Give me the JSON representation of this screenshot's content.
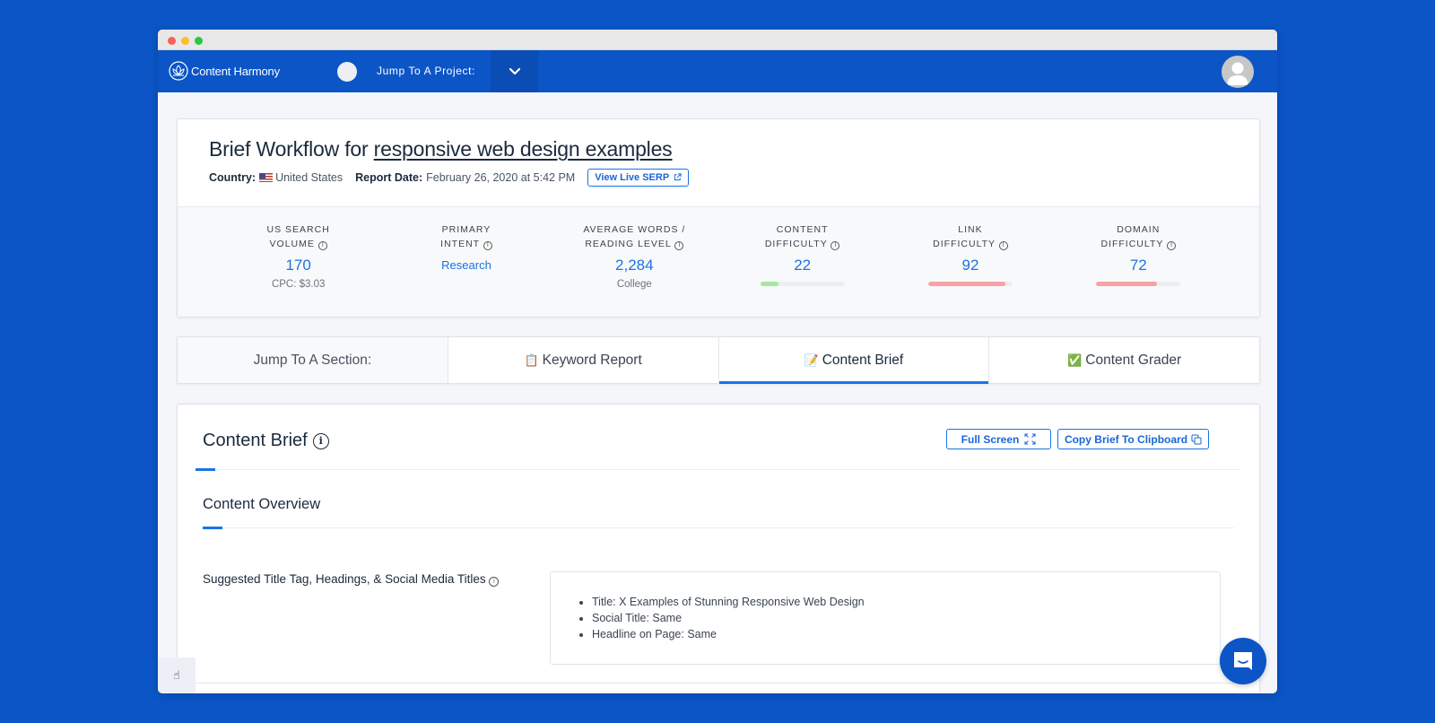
{
  "navbar": {
    "brand": "Content Harmony",
    "jump_project_label": "Jump To A Project:"
  },
  "header": {
    "title_prefix": "Brief Workflow for",
    "keyword": "responsive web design examples",
    "country_label": "Country:",
    "country": "United States",
    "report_date_label": "Report Date:",
    "report_date": "February 26, 2020 at 5:42 PM",
    "serp_button": "View Live SERP"
  },
  "stats": [
    {
      "label_line1": "US Search",
      "label_line2": "Volume",
      "value": "170",
      "sub": "CPC: $3.03"
    },
    {
      "label_line1": "Primary",
      "label_line2": "Intent",
      "value": "Research"
    },
    {
      "label_line1": "Average Words /",
      "label_line2": "Reading Level",
      "value": "2,284",
      "sub": "College"
    },
    {
      "label_line1": "Content",
      "label_line2": "Difficulty",
      "value": "22",
      "bar_percent": 22,
      "bar_color": "#a8e6a1"
    },
    {
      "label_line1": "Link",
      "label_line2": "Difficulty",
      "value": "92",
      "bar_percent": 92,
      "bar_color": "#f5a3a8"
    },
    {
      "label_line1": "Domain",
      "label_line2": "Difficulty",
      "value": "72",
      "bar_percent": 72,
      "bar_color": "#f5a3a8"
    }
  ],
  "tabs": {
    "label": "Jump To A Section:",
    "items": [
      {
        "emoji": "📋",
        "label": "Keyword Report"
      },
      {
        "emoji": "📝",
        "label": "Content Brief",
        "active": true
      },
      {
        "emoji": "✅",
        "label": "Content Grader"
      }
    ]
  },
  "brief": {
    "title": "Content Brief",
    "full_screen_button": "Full Screen",
    "copy_button": "Copy Brief To Clipboard",
    "section_title": "Content Overview",
    "field_label": "Suggested Title Tag, Headings, & Social Media Titles",
    "field_items": [
      "Title: X Examples of Stunning Responsive Web Design",
      "Social Title: Same",
      "Headline on Page: Same"
    ]
  },
  "colors": {
    "brand_blue": "#0b55c7",
    "accent_blue": "#1a73e8"
  }
}
